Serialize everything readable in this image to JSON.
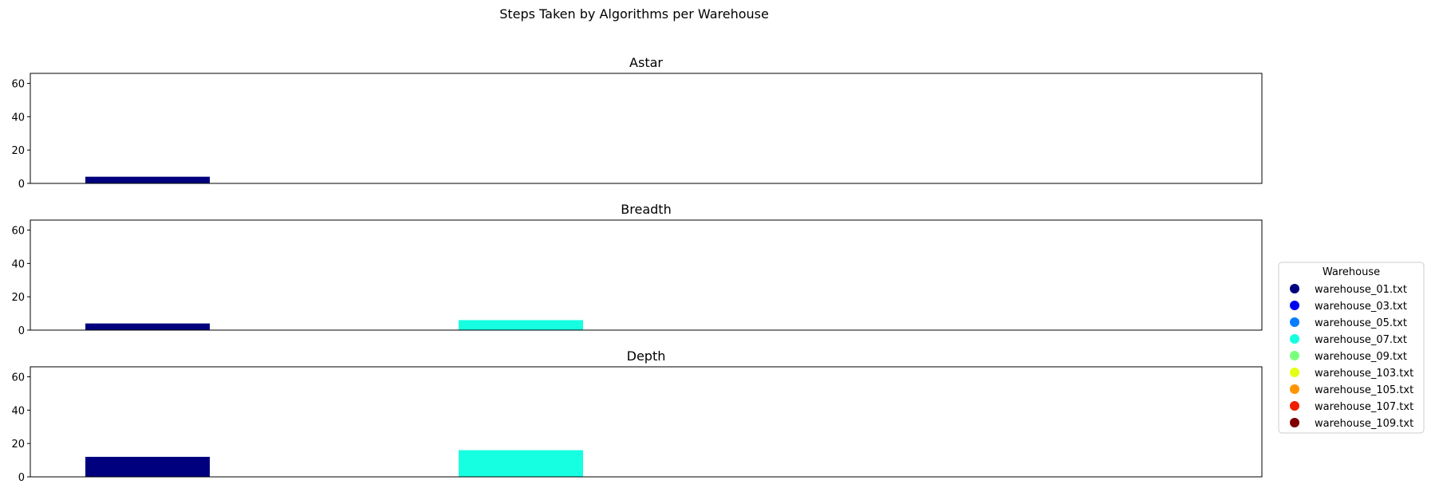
{
  "figure": {
    "title": "Steps Taken by Algorithms per Warehouse"
  },
  "legend": {
    "title": "Warehouse",
    "placement": "right",
    "entries": [
      {
        "label": "warehouse_01.txt",
        "color": "#00007f"
      },
      {
        "label": "warehouse_03.txt",
        "color": "#0000f1"
      },
      {
        "label": "warehouse_05.txt",
        "color": "#0a7cff"
      },
      {
        "label": "warehouse_07.txt",
        "color": "#16ffe1"
      },
      {
        "label": "warehouse_09.txt",
        "color": "#7bff7b"
      },
      {
        "label": "warehouse_103.txt",
        "color": "#e4ff14"
      },
      {
        "label": "warehouse_105.txt",
        "color": "#ff9400"
      },
      {
        "label": "warehouse_107.txt",
        "color": "#f11d00"
      },
      {
        "label": "warehouse_109.txt",
        "color": "#7f0000"
      }
    ]
  },
  "chart_data": [
    {
      "type": "bar",
      "title": "Astar",
      "ylim": [
        0,
        66
      ],
      "yticks": [
        0,
        20,
        40,
        60
      ],
      "grid": false,
      "categories": [
        "warehouse_01.txt",
        "warehouse_03.txt",
        "warehouse_05.txt",
        "warehouse_07.txt",
        "warehouse_09.txt",
        "warehouse_103.txt",
        "warehouse_105.txt",
        "warehouse_107.txt",
        "warehouse_109.txt"
      ],
      "values": [
        4,
        0,
        0,
        0,
        0,
        0,
        0,
        0,
        0
      ]
    },
    {
      "type": "bar",
      "title": "Breadth",
      "ylim": [
        0,
        66
      ],
      "yticks": [
        0,
        20,
        40,
        60
      ],
      "grid": false,
      "categories": [
        "warehouse_01.txt",
        "warehouse_03.txt",
        "warehouse_05.txt",
        "warehouse_07.txt",
        "warehouse_09.txt",
        "warehouse_103.txt",
        "warehouse_105.txt",
        "warehouse_107.txt",
        "warehouse_109.txt"
      ],
      "values": [
        4,
        0,
        0,
        6,
        0,
        0,
        0,
        0,
        0
      ]
    },
    {
      "type": "bar",
      "title": "Depth",
      "ylim": [
        0,
        66
      ],
      "yticks": [
        0,
        20,
        40,
        60
      ],
      "grid": false,
      "categories": [
        "warehouse_01.txt",
        "warehouse_03.txt",
        "warehouse_05.txt",
        "warehouse_07.txt",
        "warehouse_09.txt",
        "warehouse_103.txt",
        "warehouse_105.txt",
        "warehouse_107.txt",
        "warehouse_109.txt"
      ],
      "values": [
        12,
        0,
        0,
        16,
        0,
        0,
        0,
        0,
        0
      ]
    }
  ]
}
